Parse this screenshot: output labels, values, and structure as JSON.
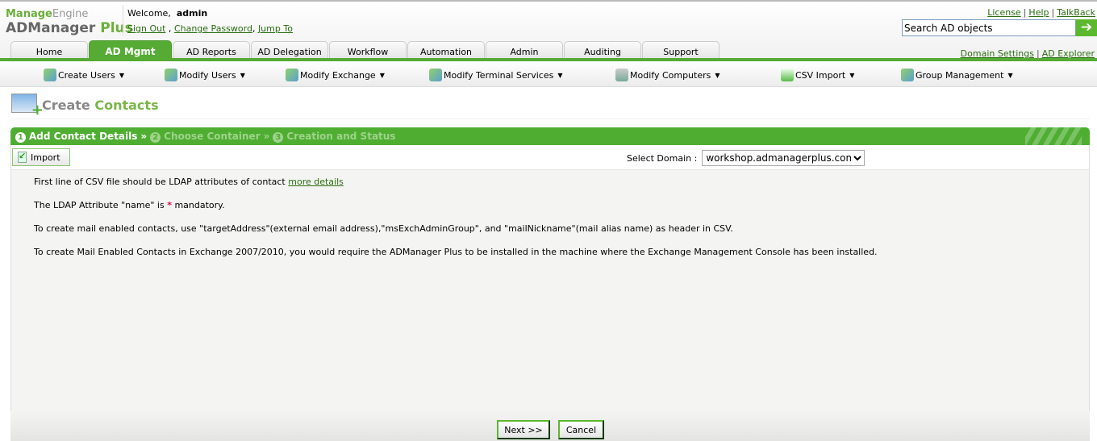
{
  "brand": {
    "company": "Manage",
    "company2": "Engine",
    "product": "ADManager",
    "product2": "Plus"
  },
  "user": {
    "welcome": "Welcome,",
    "name": "admin",
    "sign_out": "Sign Out",
    "change_password": "Change Password",
    "jump_to": "Jump To"
  },
  "toplinks": {
    "license": "License",
    "help": "Help",
    "talkback": "TalkBack"
  },
  "search": {
    "value": "Search AD objects"
  },
  "tabs": [
    "Home",
    "AD Mgmt",
    "AD Reports",
    "AD Delegation",
    "Workflow",
    "Automation",
    "Admin",
    "Auditing",
    "Support"
  ],
  "sublinks": {
    "domain_settings": "Domain Settings",
    "ad_explorer": "AD Explorer"
  },
  "menu": [
    "Create Users",
    "Modify Users",
    "Modify Exchange",
    "Modify Terminal Services",
    "Modify Computers",
    "CSV Import",
    "Group Management"
  ],
  "page": {
    "title1": "Create",
    "title2": "Contacts"
  },
  "wizard": [
    {
      "n": "1",
      "label": "Add Contact Details"
    },
    {
      "n": "2",
      "label": "Choose Container"
    },
    {
      "n": "3",
      "label": "Creation and Status"
    }
  ],
  "toolbar": {
    "import": "Import",
    "domain_label": "Select Domain :",
    "domain_value": "workshop.admanagerplus.com"
  },
  "info": {
    "line1": "First line of CSV file should be LDAP attributes of contact",
    "more_details": "more details",
    "line2a": "The LDAP Attribute \"name\" is",
    "star": "*",
    "line2b": "mandatory.",
    "line3": "To create mail enabled contacts, use \"targetAddress\"(external email address),\"msExchAdminGroup\", and \"mailNickname\"(mail alias name) as header in CSV.",
    "line4": "To create Mail Enabled Contacts in Exchange 2007/2010, you would require the ADManager Plus to be installed in the machine where the Exchange Management Console has been installed."
  },
  "buttons": {
    "next": "Next >>",
    "cancel": "Cancel"
  }
}
